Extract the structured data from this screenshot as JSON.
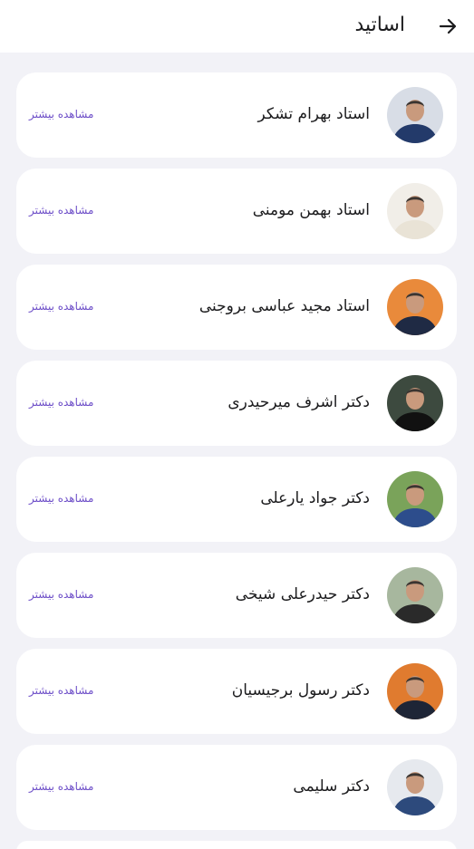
{
  "header": {
    "title": "اساتید",
    "back_icon": "arrow-right-icon"
  },
  "teachers": [
    {
      "name": "استاد بهرام تشکر",
      "more_label": "مشاهده بیشتر",
      "avatar_bg": "#d8dde6",
      "shirt": "#233a6a"
    },
    {
      "name": "استاد بهمن مومنی",
      "more_label": "مشاهده بیشتر",
      "avatar_bg": "#f1eee8",
      "shirt": "#e9e3d6"
    },
    {
      "name": "استاد مجید عباسی بروجنی",
      "more_label": "مشاهده بیشتر",
      "avatar_bg": "#e98a3b",
      "shirt": "#1f2a44"
    },
    {
      "name": "دکتر اشرف میرحیدری",
      "more_label": "مشاهده بیشتر",
      "avatar_bg": "#3d4a3f",
      "shirt": "#111111"
    },
    {
      "name": "دکتر جواد یارعلی",
      "more_label": "مشاهده بیشتر",
      "avatar_bg": "#7aa35a",
      "shirt": "#2d4d8c"
    },
    {
      "name": "دکتر حیدرعلی شیخی",
      "more_label": "مشاهده بیشتر",
      "avatar_bg": "#a7b79e",
      "shirt": "#2a2a2a"
    },
    {
      "name": "دکتر رسول برجیسیان",
      "more_label": "مشاهده بیشتر",
      "avatar_bg": "#e07b2f",
      "shirt": "#1e2536"
    },
    {
      "name": "دکتر سلیمی",
      "more_label": "مشاهده بیشتر",
      "avatar_bg": "#e6e9ee",
      "shirt": "#2d4a7c"
    }
  ],
  "colors": {
    "background": "#f2f2f7",
    "card": "#ffffff",
    "link": "#6d4ec8",
    "text": "#1c1c1e"
  }
}
